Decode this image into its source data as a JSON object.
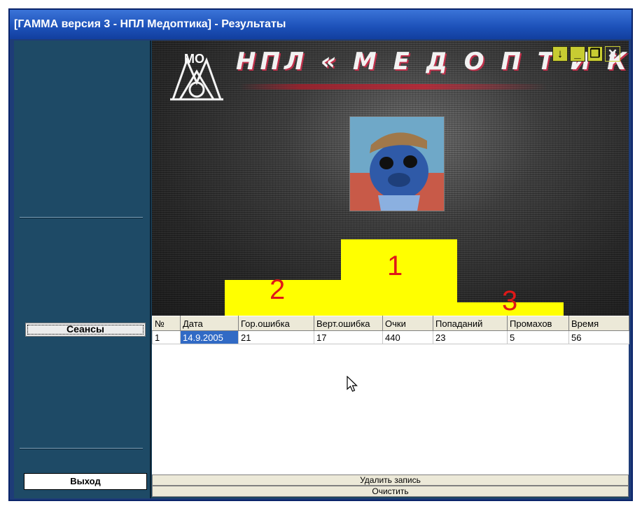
{
  "window": {
    "title": "[ГАММА версия 3 - НПЛ Медоптика] - Результаты"
  },
  "sidebar": {
    "sessions_label": "Сеансы",
    "exit_label": "Выход"
  },
  "display": {
    "brand_text": "НПЛ « М Е Д О П Т И К А »",
    "logo_letters": "МО",
    "controls": {
      "download_glyph": "↓",
      "minimize_glyph": "_",
      "restore_glyph": "❐",
      "close_glyph": "✕"
    },
    "podium": {
      "first": "1",
      "second": "2",
      "third": "3"
    },
    "colors": {
      "podium": "#ffff00",
      "place_numbers": "#e01818"
    }
  },
  "results": {
    "columns": [
      "№",
      "Дата",
      "Гор.ошибка",
      "Верт.ошибка",
      "Очки",
      "Попаданий",
      "Промахов",
      "Время"
    ],
    "rows": [
      [
        "1",
        "14.9.2005",
        "21",
        "17",
        "440",
        "23",
        "5",
        "56"
      ]
    ]
  },
  "actions": {
    "delete_label": "Удалить запись",
    "clear_label": "Очистить"
  }
}
